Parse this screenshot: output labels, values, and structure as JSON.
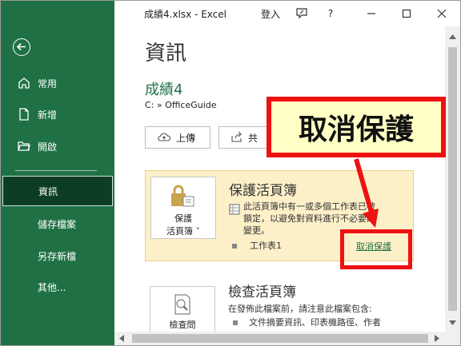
{
  "window": {
    "title": "成績4.xlsx  -  Excel",
    "signin": "登入",
    "help": "?"
  },
  "sidebar": {
    "items": [
      {
        "label": "常用",
        "icon": "home-icon"
      },
      {
        "label": "新增",
        "icon": "new-document-icon"
      },
      {
        "label": "開啟",
        "icon": "open-folder-icon"
      },
      {
        "label": "資訊"
      },
      {
        "label": "儲存檔案"
      },
      {
        "label": "另存新檔"
      },
      {
        "label": "其他..."
      }
    ]
  },
  "main": {
    "title": "資訊",
    "doc_name": "成績4",
    "path": "C: » OfficeGuide",
    "buttons": {
      "upload": "上傳",
      "share": "共"
    },
    "protect": {
      "button_line1": "保護",
      "button_line2": "活頁簿",
      "title": "保護活頁簿",
      "desc_line1": "此活頁簿中有一或多個工作表已被",
      "desc_line2": "鎖定，以避免對資料進行不必要的",
      "desc_line3": "變更。",
      "sheet": "工作表1",
      "unprotect_link": "取消保護"
    },
    "inspect": {
      "button_line1": "檢查問",
      "button_line2": "題",
      "title": "檢查活頁簿",
      "desc": "在發佈此檔案前，請注意此檔案包含:",
      "bullet1": "文件摘要資訊、印表機路徑、作者"
    }
  },
  "annotation": {
    "callout_text": "取消保護",
    "color": "#ee1111"
  },
  "colors": {
    "accent": "#1f7145",
    "selected": "#0d3d23",
    "card": "#fdf0c9"
  }
}
